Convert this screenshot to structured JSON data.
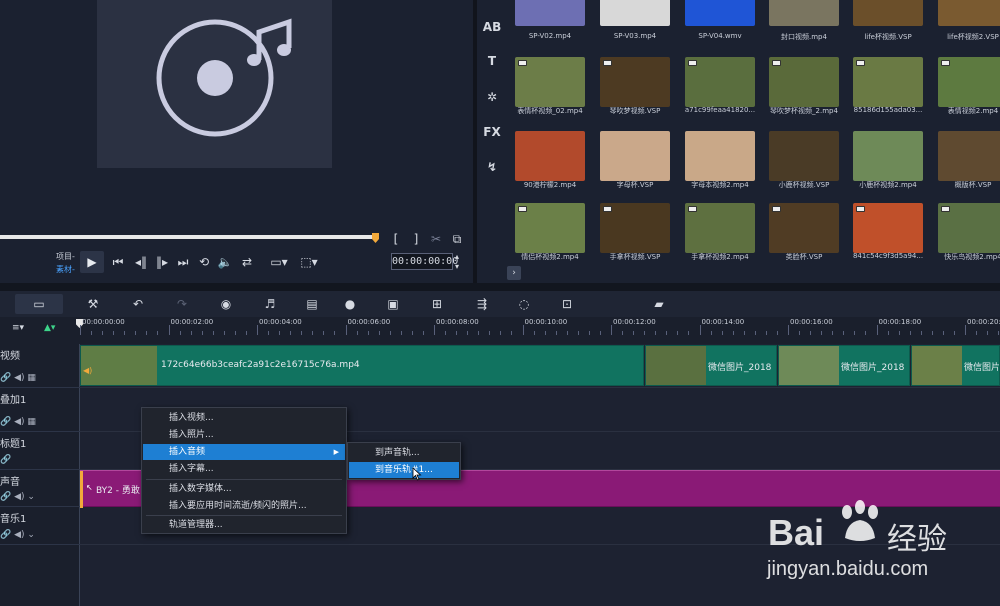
{
  "preview": {
    "project_label": "项目-",
    "clip_label": "素材-",
    "timecode": "00:00:00:00",
    "bracket_in": "[",
    "bracket_out": "]"
  },
  "side_tools": [
    {
      "name": "title-icon",
      "glyph": "AB"
    },
    {
      "name": "text-icon",
      "glyph": "T"
    },
    {
      "name": "graphics-icon",
      "glyph": "✲"
    },
    {
      "name": "fx-icon",
      "glyph": "FX"
    },
    {
      "name": "path-icon",
      "glyph": "↯"
    }
  ],
  "library": {
    "items": [
      {
        "name": "SP-V02.mp4",
        "color": "#6d6fb3",
        "badge": false
      },
      {
        "name": "SP-V03.mp4",
        "color": "#d8d8d8",
        "badge": false
      },
      {
        "name": "SP-V04.wmv",
        "color": "#1f55d6",
        "badge": false
      },
      {
        "name": "封口视频.mp4",
        "color": "#7a7560",
        "badge": false
      },
      {
        "name": "life杯视频.VSP",
        "color": "#6b4f2a",
        "badge": false
      },
      {
        "name": "life杯视频2.VSP",
        "color": "#7a5a30",
        "badge": false
      },
      {
        "name": "表情杯视频_02.mp4",
        "color": "#6c7d48",
        "badge": true
      },
      {
        "name": "琴吹梦视频.VSP",
        "color": "#4d3a22",
        "badge": true
      },
      {
        "name": "a71c99feaa41820...",
        "color": "#5a6e3e",
        "badge": true
      },
      {
        "name": "琴吹梦杯视频_2.mp4",
        "color": "#5a6a3a",
        "badge": true
      },
      {
        "name": "85186d155ada03...",
        "color": "#6a7a44",
        "badge": true
      },
      {
        "name": "表情视频2.mp4",
        "color": "#5d7a40",
        "badge": true
      },
      {
        "name": "90港柠檬2.mp4",
        "color": "#b24a2c",
        "badge": false
      },
      {
        "name": "字母杯.VSP",
        "color": "#caa88a",
        "badge": false
      },
      {
        "name": "字母本视频2.mp4",
        "color": "#c9a888",
        "badge": false
      },
      {
        "name": "小鹿杯视频.VSP",
        "color": "#4a3b26",
        "badge": false
      },
      {
        "name": "小鹿杯视频2.mp4",
        "color": "#6e8a58",
        "badge": false
      },
      {
        "name": "概版杯.VSP",
        "color": "#5f4a30",
        "badge": false
      },
      {
        "name": "情侣杯视频2.mp4",
        "color": "#6b8048",
        "badge": true
      },
      {
        "name": "手拿杯视频.VSP",
        "color": "#4a3820",
        "badge": true
      },
      {
        "name": "手拿杯视频2.mp4",
        "color": "#5e7040",
        "badge": true
      },
      {
        "name": "类脸杯.VSP",
        "color": "#503c24",
        "badge": true
      },
      {
        "name": "841c54c9f3d5a94...",
        "color": "#c0502a",
        "badge": true
      },
      {
        "name": "快乐鸟视频2.mp4",
        "color": "#5a7044",
        "badge": true
      }
    ],
    "expand_glyph": "›"
  },
  "timeline": {
    "ticks": [
      "00:00:00:00",
      "00:00:02:00",
      "00:00:04:00",
      "00:00:06:00",
      "00:00:08:00",
      "00:00:10:00",
      "00:00:12:00",
      "00:00:14:00",
      "00:00:16:00",
      "00:00:18:00",
      "00:00:20:0"
    ],
    "tracks": [
      {
        "id": "video",
        "label": "视频"
      },
      {
        "id": "overlay",
        "label": "叠加1"
      },
      {
        "id": "title",
        "label": "标题1"
      },
      {
        "id": "voice",
        "label": "声音"
      },
      {
        "id": "music",
        "label": "音乐1"
      }
    ],
    "video_clips": [
      {
        "label": "172c64e66b3ceafc2a91c2e16715c76a.mp4",
        "thumb": "#5f7d45"
      },
      {
        "label": "微信图片_2018",
        "thumb": "#5a7040"
      },
      {
        "label": "微信图片_2018",
        "thumb": "#6e8a58"
      },
      {
        "label": "微信图片",
        "thumb": "#6b8048"
      }
    ],
    "audio_clip_label": "BY2 - 勇敢"
  },
  "context_menu": {
    "items": [
      "插入视频...",
      "插入照片...",
      "插入音频",
      "插入字幕...",
      "插入数字媒体...",
      "插入要应用时间流逝/频闪的照片...",
      "轨道管理器..."
    ],
    "highlighted_index": 2,
    "submenu": [
      "到声音轨...",
      "到音乐轨#1..."
    ],
    "submenu_highlighted_index": 1
  },
  "watermark": {
    "brand": "Bai",
    "brand2": "经验",
    "url": "jingyan.baidu.com"
  },
  "colors": {
    "video_clip": "#117360",
    "audio_clip": "#8a1a76",
    "menu_highlight": "#1e7fd3",
    "playhead": "#f2a93b"
  }
}
